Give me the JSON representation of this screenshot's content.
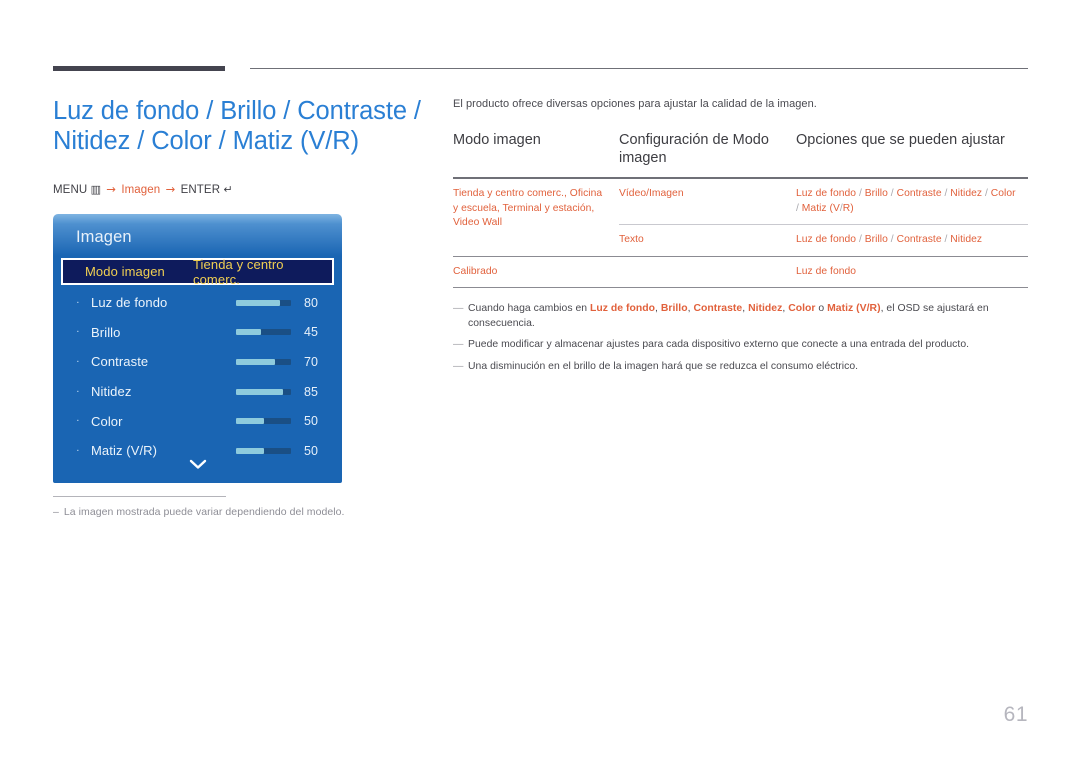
{
  "header": {
    "title": "Luz de fondo / Brillo / Contraste /\nNitidez / Color / Matiz (V/R)",
    "menu_path": {
      "menu_label": "MENU",
      "menu_icon": "▥",
      "arrow": "→",
      "target": "Imagen",
      "enter_label": "ENTER",
      "enter_icon": "↵"
    }
  },
  "osd": {
    "title": "Imagen",
    "selected": {
      "label": "Modo imagen",
      "value": "Tienda y centro comerc."
    },
    "bullet": "·",
    "items": [
      {
        "label": "Luz de fondo",
        "value": "80",
        "percent": 80
      },
      {
        "label": "Brillo",
        "value": "45",
        "percent": 45
      },
      {
        "label": "Contraste",
        "value": "70",
        "percent": 70
      },
      {
        "label": "Nitidez",
        "value": "85",
        "percent": 85
      },
      {
        "label": "Color",
        "value": "50",
        "percent": 50
      },
      {
        "label": "Matiz (V/R)",
        "value": "50",
        "percent": 50
      }
    ],
    "more_icon": "⌄"
  },
  "left_note": {
    "dash": "–",
    "text": "La imagen mostrada puede variar dependiendo del modelo."
  },
  "content": {
    "intro": "El producto ofrece diversas opciones para ajustar la calidad de la imagen.",
    "table": {
      "headers": [
        "Modo imagen",
        "Configuración de Modo imagen",
        "Opciones que se pueden ajustar"
      ],
      "rows": [
        {
          "mode": "Tienda y centro comerc., Oficina y escuela, Terminal y estación, Video Wall",
          "setting": "Vídeo/Imagen",
          "options": "Luz de fondo / Brillo / Contraste / Nitidez / Color / Matiz (V/R)"
        },
        {
          "mode": "",
          "setting": "Texto",
          "options": "Luz de fondo / Brillo / Contraste / Nitidez"
        },
        {
          "mode": "Calibrado",
          "setting": "",
          "options": "Luz de fondo"
        }
      ]
    },
    "notes": [
      {
        "tick": "―",
        "parts": [
          {
            "t": "Cuando haga cambios en ",
            "b": false
          },
          {
            "t": "Luz de fondo",
            "b": true
          },
          {
            "t": ", ",
            "b": false
          },
          {
            "t": "Brillo",
            "b": true
          },
          {
            "t": ", ",
            "b": false
          },
          {
            "t": "Contraste",
            "b": true
          },
          {
            "t": ", ",
            "b": false
          },
          {
            "t": "Nitidez",
            "b": true
          },
          {
            "t": ", ",
            "b": false
          },
          {
            "t": "Color",
            "b": true
          },
          {
            "t": " o ",
            "b": false
          },
          {
            "t": "Matiz (V/R)",
            "b": true
          },
          {
            "t": ", el OSD se ajustará en consecuencia.",
            "b": false
          }
        ]
      },
      {
        "tick": "―",
        "parts": [
          {
            "t": "Puede modificar y almacenar ajustes para cada dispositivo externo que conecte a una entrada del producto.",
            "b": false
          }
        ]
      },
      {
        "tick": "―",
        "parts": [
          {
            "t": "Una disminución en el brillo de la imagen hará que se reduzca el consumo eléctrico.",
            "b": false
          }
        ]
      }
    ]
  },
  "page_number": "61",
  "colors": {
    "title_blue": "#2a7fd4",
    "accent_orange": "#e1613c",
    "osd_blue": "#1a65b3",
    "osd_highlight_bg": "#0e1b5c",
    "osd_highlight_text": "#f0cf52",
    "slider_fill": "#8ecbdd",
    "slider_track": "#1a4f85",
    "rule_dark": "#44444f"
  }
}
